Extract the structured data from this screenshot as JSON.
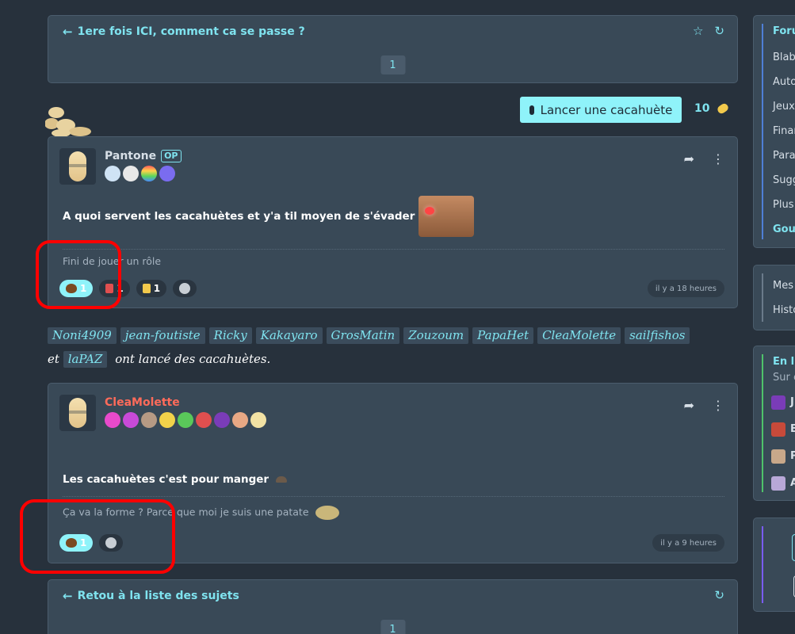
{
  "topic": {
    "title": "1ere fois ICI, comment ca se passe ?",
    "page": "1"
  },
  "launch": {
    "label": "Lancer une cacahuète",
    "count": "10"
  },
  "posts": [
    {
      "author": "Pantone",
      "op_label": "OP",
      "text": "A quoi servent les cacahuètes et y'a til moyen de s'évader",
      "signature": "Fini de jouer un rôle",
      "reactions": [
        {
          "icon": "poop",
          "count": "1",
          "active": true
        },
        {
          "icon": "mushroom",
          "count": "1",
          "active": false
        },
        {
          "icon": "thumbs-down",
          "count": "1",
          "active": false
        },
        {
          "icon": "add-reaction",
          "count": "",
          "active": false
        }
      ],
      "time": "il y a 18 heures"
    },
    {
      "author": "CleaMolette",
      "text": "Les cacahuètes c'est pour manger",
      "signature": "Ça va la forme ? Parce que moi je suis une patate",
      "reactions": [
        {
          "icon": "poop",
          "count": "1",
          "active": true
        },
        {
          "icon": "add-reaction",
          "count": "",
          "active": false
        }
      ],
      "time": "il y a 9 heures"
    }
  ],
  "launchers": {
    "names": [
      "Noni4909",
      "jean-foutiste",
      "Ricky",
      "Kakayaro",
      "GrosMatin",
      "Zouzoum",
      "PapaHet",
      "CleaMolette",
      "sailfishos"
    ],
    "and_word": "et",
    "last": "laPAZ",
    "suffix": "ont lancé des cacahuètes."
  },
  "footer": {
    "back_label": "Retou à la liste des sujets",
    "page": "1"
  },
  "sidebar": {
    "forums_title": "Foru",
    "forums": [
      "Blabl",
      "Auto",
      "Jeux",
      "Finar",
      "Para",
      "Sugg",
      "Plus"
    ],
    "forums_last": "Goul",
    "my": [
      "Mes",
      "Histo"
    ],
    "online_title": "En li",
    "online_sub": "Sur c",
    "online_users": [
      "J",
      "B",
      "P",
      "A"
    ]
  },
  "colors": {
    "accent": "#7fe3ef",
    "author_red": "#ff6b5a",
    "annotation": "#ff0000"
  }
}
